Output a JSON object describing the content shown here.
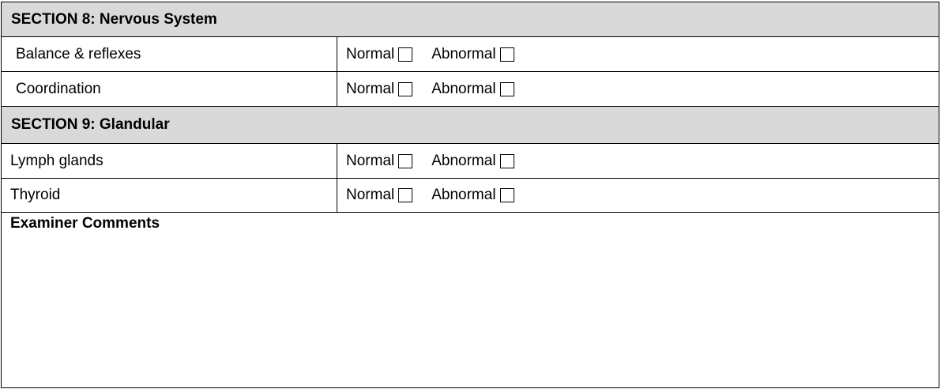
{
  "sections": [
    {
      "title": "SECTION 8: Nervous System",
      "items": [
        {
          "label": "Balance & reflexes",
          "option_normal": "Normal",
          "option_abnormal": "Abnormal",
          "normal_checked": false,
          "abnormal_checked": false
        },
        {
          "label": "Coordination",
          "option_normal": "Normal",
          "option_abnormal": "Abnormal",
          "normal_checked": false,
          "abnormal_checked": false
        }
      ]
    },
    {
      "title": "SECTION 9: Glandular",
      "items": [
        {
          "label": "Lymph glands",
          "option_normal": "Normal",
          "option_abnormal": "Abnormal",
          "normal_checked": false,
          "abnormal_checked": false
        },
        {
          "label": "Thyroid",
          "option_normal": "Normal",
          "option_abnormal": "Abnormal",
          "normal_checked": false,
          "abnormal_checked": false
        }
      ]
    }
  ],
  "comments": {
    "title": "Examiner Comments",
    "value": ""
  },
  "colors": {
    "section_header_bg": "#d9d9d9",
    "border": "#000000",
    "background": "#ffffff"
  },
  "icons": {
    "checkbox": "empty-checkbox-icon"
  }
}
